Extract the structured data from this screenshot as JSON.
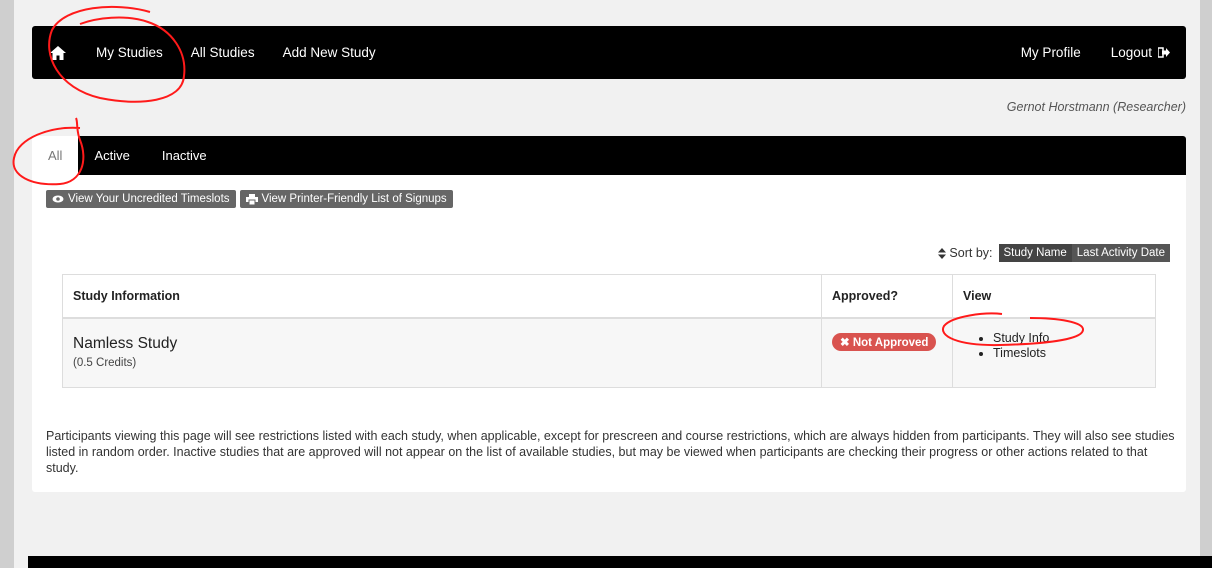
{
  "topnav": {
    "items": [
      "My Studies",
      "All Studies",
      "Add New Study"
    ],
    "right": {
      "profile": "My Profile",
      "logout": "Logout"
    }
  },
  "user": {
    "label": "Gernot Horstmann (Researcher)"
  },
  "subnav": {
    "tabs": [
      "All",
      "Active",
      "Inactive"
    ],
    "active_index": 0
  },
  "buttons": {
    "uncredited": "View Your Uncredited Timeslots",
    "printer": "View Printer-Friendly List of Signups"
  },
  "sort": {
    "label": "Sort by:",
    "options": [
      "Study Name",
      "Last Activity Date"
    ]
  },
  "table": {
    "headers": [
      "Study Information",
      "Approved?",
      "View"
    ],
    "rows": [
      {
        "title": "Namless Study",
        "credits": "(0.5 Credits)",
        "approved_badge": "Not Approved",
        "view_links": [
          "Study Info",
          "Timeslots"
        ]
      }
    ]
  },
  "note": "Participants viewing this page will see restrictions listed with each study, when applicable, except for prescreen and course restrictions, which are always hidden from participants. They will also see studies listed in random order.  Inactive studies that are approved will not appear on the list of available studies, but may be viewed when participants are checking their progress or other actions related to that study.",
  "colors": {
    "nav_bg": "#000000",
    "badge_red": "#d9534f",
    "annotation_red": "#ff1a1a",
    "button_gray": "#666666"
  }
}
